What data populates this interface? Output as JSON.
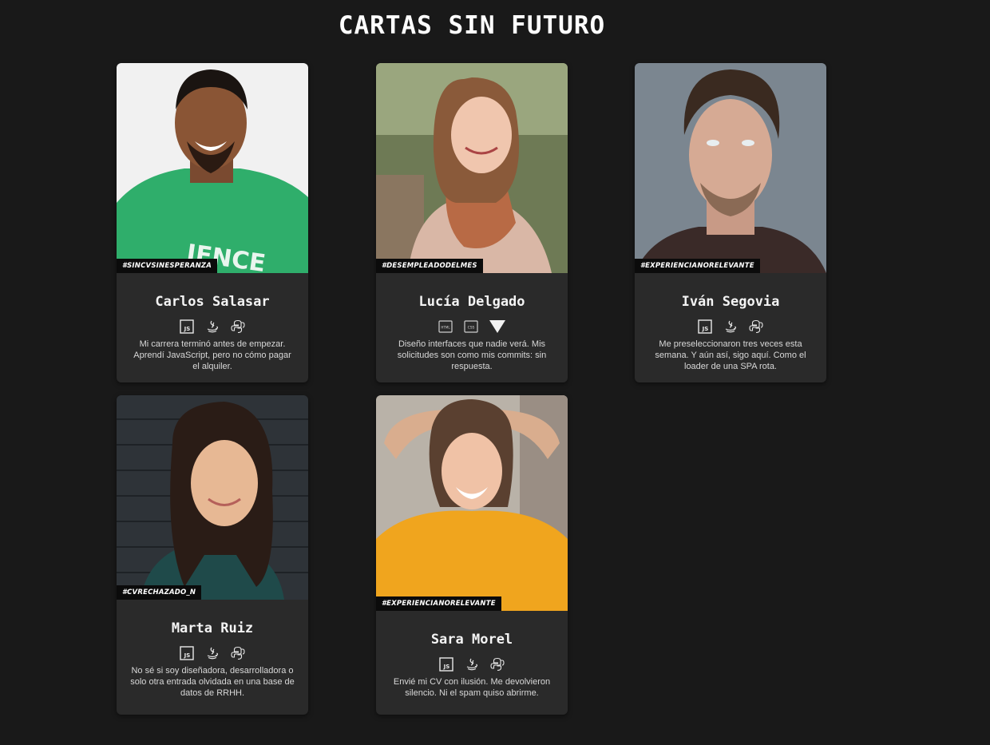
{
  "page": {
    "title": "CARTAS SIN FUTURO"
  },
  "cards": [
    {
      "name": "Carlos Salasar",
      "tag": "#SINCVSINESPERANZA",
      "icons": [
        "js-icon",
        "java-icon",
        "python-icon"
      ],
      "description": "Mi carrera terminó antes de empezar. Aprendí JavaScript, pero no cómo pagar el alquiler.",
      "shirt_text": "IENCE"
    },
    {
      "name": "Lucía Delgado",
      "tag": "#DESEMPLEADODELMES",
      "icons": [
        "html-icon",
        "css-icon",
        "vue-icon"
      ],
      "description": "Diseño interfaces que nadie verá. Mis solicitudes son como mis commits: sin respuesta."
    },
    {
      "name": "Iván Segovia",
      "tag": "#EXPERIENCIANORELEVANTE",
      "icons": [
        "js-icon",
        "java-icon",
        "python-icon"
      ],
      "description": "Me preseleccionaron tres veces esta semana. Y aún así, sigo aquí. Como el loader de una SPA rota."
    },
    {
      "name": "Marta Ruiz",
      "tag": "#CVRECHAZADO_N",
      "icons": [
        "js-icon",
        "java-icon",
        "python-icon"
      ],
      "description": "No sé si soy diseñadora, desarrolladora o solo otra entrada olvidada en una base de datos de RRHH."
    },
    {
      "name": "Sara Morel",
      "tag": "#EXPERIENCIANORELEVANTE",
      "icons": [
        "js-icon",
        "java-icon",
        "python-icon"
      ],
      "description": "Envié mi CV con ilusión. Me devolvieron silencio. Ni el spam quiso abrirme."
    }
  ],
  "icon_labels": {
    "js": "JS",
    "html": "HTML",
    "css": "CSS"
  },
  "colors": {
    "background": "#191919",
    "card": "#2a2a2a",
    "tag_bg": "#0b0b0b",
    "text": "#ffffff"
  }
}
